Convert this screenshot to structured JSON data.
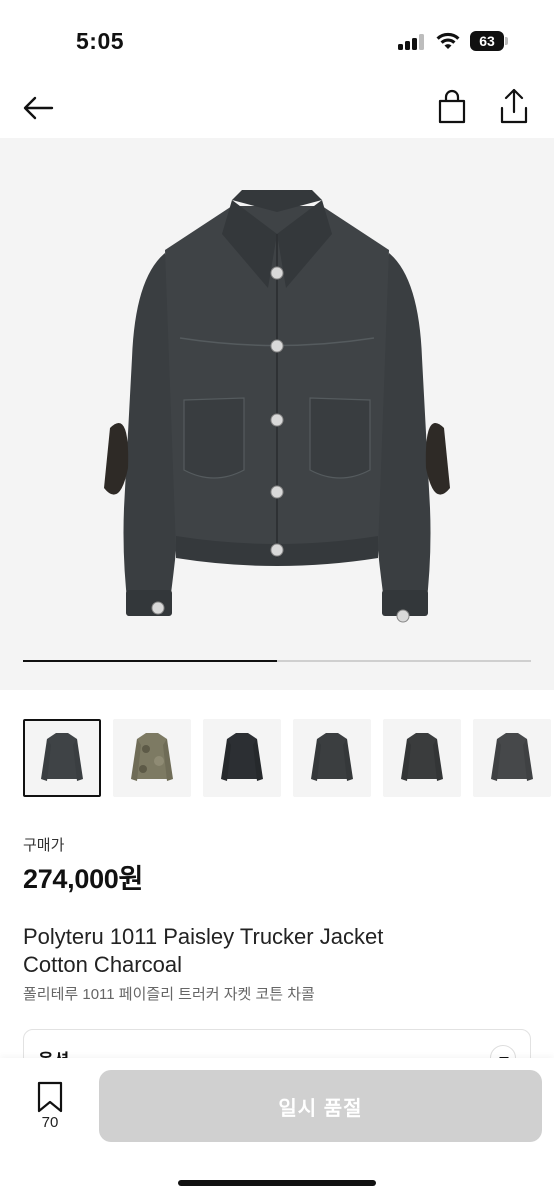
{
  "status_bar": {
    "time": "5:05",
    "battery": "63",
    "icons": [
      "signal-icon",
      "wifi-icon",
      "battery-icon"
    ]
  },
  "nav": {
    "icons": [
      "back-arrow-icon",
      "shopping-bag-icon",
      "share-icon"
    ]
  },
  "gallery": {
    "progress": 0.5,
    "thumbnail_count": 6,
    "selected_index": 0
  },
  "product": {
    "price_label": "구매가",
    "price": "274,000원",
    "title_line1": "Polyteru 1011 Paisley Trucker Jacket",
    "title_line2": "Cotton Charcoal",
    "title_ko": "폴리테루 1011 페이즐리 트러커 자켓 코튼 차콜"
  },
  "option": {
    "label": "옵션"
  },
  "bottom_bar": {
    "bookmark_count": "70",
    "action_label": "일시 품절"
  },
  "colors": {
    "accent": "#111111",
    "disabled_button": "#d0d0d0",
    "hero_background": "#f4f4f4"
  }
}
